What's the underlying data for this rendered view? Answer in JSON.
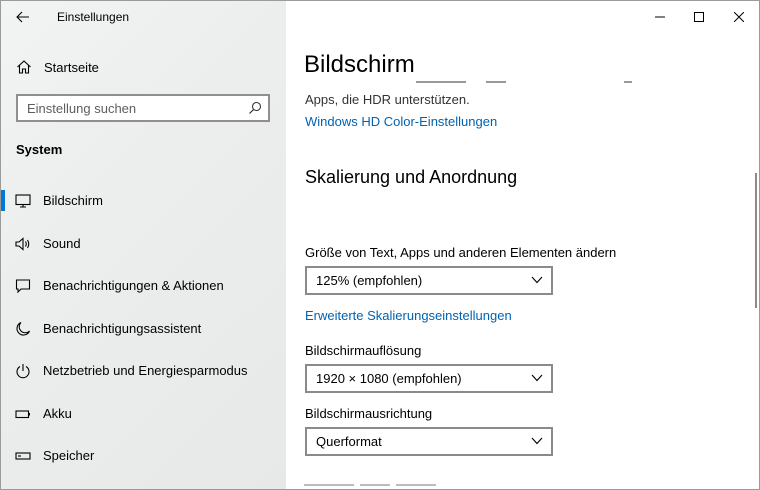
{
  "window": {
    "title": "Einstellungen"
  },
  "sidebar": {
    "home_label": "Startseite",
    "search_placeholder": "Einstellung suchen",
    "section_header": "System",
    "items": [
      {
        "label": "Bildschirm",
        "icon": "monitor-icon",
        "selected": true
      },
      {
        "label": "Sound",
        "icon": "speaker-icon",
        "selected": false
      },
      {
        "label": "Benachrichtigungen & Aktionen",
        "icon": "notification-icon",
        "selected": false
      },
      {
        "label": "Benachrichtigungsassistent",
        "icon": "moon-icon",
        "selected": false
      },
      {
        "label": "Netzbetrieb und Energiesparmodus",
        "icon": "power-icon",
        "selected": false
      },
      {
        "label": "Akku",
        "icon": "battery-icon",
        "selected": false
      },
      {
        "label": "Speicher",
        "icon": "storage-icon",
        "selected": false
      }
    ]
  },
  "content": {
    "page_title": "Bildschirm",
    "hdr_text": "Apps, die HDR unterstützen.",
    "hdr_link": "Windows HD Color-Einstellungen",
    "section_title": "Skalierung und Anordnung",
    "scale_label": "Größe von Text, Apps und anderen Elementen ändern",
    "scale_value": "125% (empfohlen)",
    "advanced_scaling_link": "Erweiterte Skalierungseinstellungen",
    "resolution_label": "Bildschirmauflösung",
    "resolution_value": "1920 × 1080 (empfohlen)",
    "orientation_label": "Bildschirmausrichtung",
    "orientation_value": "Querformat"
  },
  "colors": {
    "accent": "#0078d7",
    "link": "#0063b1"
  }
}
